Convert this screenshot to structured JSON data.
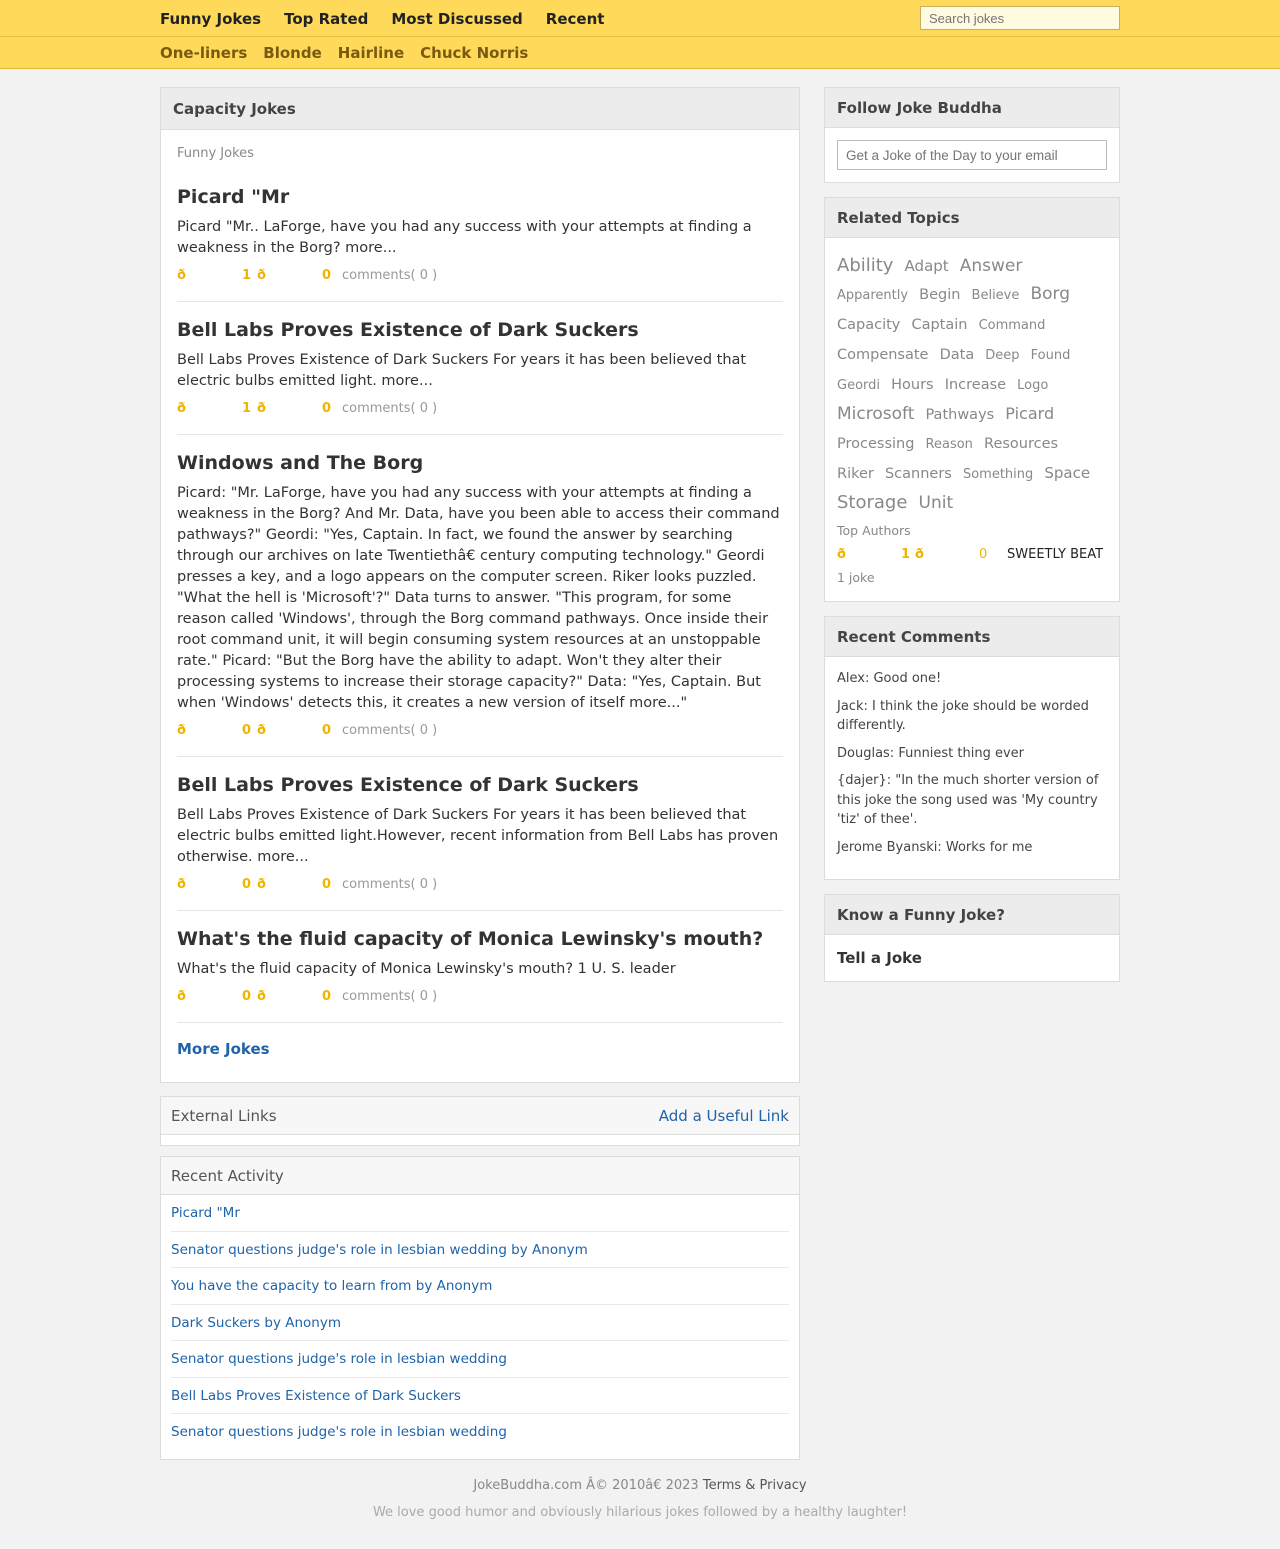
{
  "nav": {
    "items": [
      "Funny Jokes",
      "Top Rated",
      "Most Discussed",
      "Recent"
    ],
    "search_placeholder": "Search jokes"
  },
  "subnav": {
    "items": [
      "One-liners",
      "Blonde",
      "Hairline",
      "Chuck Norris"
    ]
  },
  "jokes": {
    "title": "Capacity Jokes",
    "breadcrumb": "Funny Jokes",
    "items": [
      {
        "title": "Picard \"Mr",
        "text": "Picard \"Mr.. LaForge, have you had any success with your attempts at finding a weakness in the Borg? more...",
        "up_icon": "ð",
        "up_count": "1",
        "down_icon": "ð",
        "down_count": "0",
        "comments": "comments( 0 )"
      },
      {
        "title": "Bell Labs Proves Existence of Dark Suckers",
        "text": "Bell Labs Proves Existence of Dark Suckers For years it has been believed that electric bulbs emitted light. more...",
        "up_icon": "ð",
        "up_count": "1",
        "down_icon": "ð",
        "down_count": "0",
        "comments": "comments( 0 )"
      },
      {
        "title": "Windows and The Borg",
        "text": "Picard: \"Mr. LaForge, have you had any success with your attempts at finding a weakness in the Borg? And Mr. Data, have you been able to access their command pathways?\" Geordi: \"Yes, Captain. In fact, we found the answer by searching through our archives on late Twentiethâ€  century computing technology.\" Geordi presses a key, and a logo appears on the computer screen. Riker looks puzzled. \"What the hell is 'Microsoft'?\" Data turns to answer. \"This program, for some reason called 'Windows', through the Borg command pathways. Once inside their root command unit, it will begin consuming system resources at an unstoppable rate.\" Picard: \"But the Borg have the ability to adapt. Won't they alter their processing systems to increase their storage capacity?\" Data: \"Yes, Captain. But when 'Windows' detects this, it creates a new version of itself more...\"",
        "up_icon": "ð",
        "up_count": "0",
        "down_icon": "ð",
        "down_count": "0",
        "comments": "comments( 0 )"
      },
      {
        "title": "Bell Labs Proves Existence of Dark Suckers",
        "text": "Bell Labs Proves Existence of Dark Suckers For years it has been believed that electric bulbs emitted light.However, recent information from Bell Labs has proven otherwise. more...",
        "up_icon": "ð",
        "up_count": "0",
        "down_icon": "ð",
        "down_count": "0",
        "comments": "comments( 0 )"
      },
      {
        "title": "What's the fluid capacity of Monica Lewinsky's mouth?",
        "text": "What's the fluid capacity of Monica Lewinsky's mouth? 1 U. S. leader",
        "up_icon": "ð",
        "up_count": "0",
        "down_icon": "ð",
        "down_count": "0",
        "comments": "comments( 0 )"
      }
    ],
    "more_label": "More Jokes"
  },
  "external_links": {
    "title": "External Links",
    "add_label": "Add a Useful Link"
  },
  "recent_activity": {
    "title": "Recent Activity",
    "items": [
      "Picard \"Mr",
      "Senator questions judge's role in lesbian wedding by Anonym",
      "You have the capacity to learn from by Anonym",
      "Dark Suckers by Anonym",
      "Senator questions judge's role in lesbian wedding",
      "Bell Labs Proves Existence of Dark Suckers",
      "Senator questions judge's role in lesbian wedding"
    ]
  },
  "follow": {
    "title": "Follow Joke Buddha",
    "email_placeholder": "Get a Joke of the Day to your email"
  },
  "related": {
    "title": "Related Topics",
    "tags": [
      {
        "label": "Ability",
        "size": 18
      },
      {
        "label": "Adapt",
        "size": 15
      },
      {
        "label": "Answer",
        "size": 17
      },
      {
        "label": "Apparently",
        "size": 13
      },
      {
        "label": "Begin",
        "size": 14.5
      },
      {
        "label": "Believe",
        "size": 13
      },
      {
        "label": "Borg",
        "size": 17
      },
      {
        "label": "Capacity",
        "size": 14.5
      },
      {
        "label": "Captain",
        "size": 14.5
      },
      {
        "label": "Command",
        "size": 13
      },
      {
        "label": "Compensate",
        "size": 14.5
      },
      {
        "label": "Data",
        "size": 14.5
      },
      {
        "label": "Deep",
        "size": 13
      },
      {
        "label": "Found",
        "size": 13
      },
      {
        "label": "Geordi",
        "size": 13
      },
      {
        "label": "Hours",
        "size": 14.5
      },
      {
        "label": "Increase",
        "size": 14.5
      },
      {
        "label": "Logo",
        "size": 13
      },
      {
        "label": "Microsoft",
        "size": 17
      },
      {
        "label": "Pathways",
        "size": 14.5
      },
      {
        "label": "Picard",
        "size": 16
      },
      {
        "label": "Processing",
        "size": 14.5
      },
      {
        "label": "Reason",
        "size": 13
      },
      {
        "label": "Resources",
        "size": 14.5
      },
      {
        "label": "Riker",
        "size": 14.5
      },
      {
        "label": "Scanners",
        "size": 14.5
      },
      {
        "label": "Something",
        "size": 13
      },
      {
        "label": "Space",
        "size": 15
      },
      {
        "label": "Storage",
        "size": 18
      },
      {
        "label": "Unit",
        "size": 17
      }
    ],
    "top_authors_label": "Top Authors",
    "author": {
      "up_icon": "ð",
      "up_count": "1",
      "down_icon": "ð",
      "down_count": "0",
      "name": "SWEETLY BEAT",
      "jokes": "1 joke"
    }
  },
  "recent_comments": {
    "title": "Recent Comments",
    "items": [
      "Alex: Good one!",
      "Jack: I think the joke should be worded differently.",
      "Douglas: Funniest thing ever",
      "{dajer}: \"In the much shorter version of this joke the song used was 'My country 'tiz' of thee'.",
      "Jerome Byanski: Works for me"
    ]
  },
  "tell": {
    "title": "Know a Funny Joke?",
    "link": "Tell a Joke"
  },
  "footer": {
    "copyright": "JokeBuddha.com Â© 2010â€  2023",
    "terms": "Terms & Privacy",
    "tagline": "We love good humor and obviously hilarious jokes followed by a healthy laughter!"
  }
}
